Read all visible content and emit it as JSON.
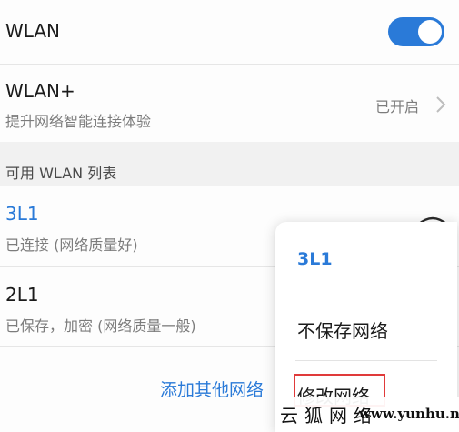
{
  "wlan": {
    "label": "WLAN",
    "enabled": true
  },
  "wlan_plus": {
    "label": "WLAN+",
    "description": "提升网络智能连接体验",
    "status": "已开启"
  },
  "section_header": "可用 WLAN 列表",
  "networks": [
    {
      "ssid": "3L1",
      "status": "已连接 (网络质量好)"
    },
    {
      "ssid": "2L1",
      "status": "已保存，加密 (网络质量一般)"
    }
  ],
  "add_network_label": "添加其他网络",
  "context_menu": {
    "title": "3L1",
    "items": [
      "不保存网络",
      "修改网络"
    ]
  },
  "watermark": {
    "cn": "云狐网络",
    "url": "www.yunhu.net"
  },
  "colors": {
    "accent": "#2a7ad8",
    "highlight": "#e03a3a"
  }
}
